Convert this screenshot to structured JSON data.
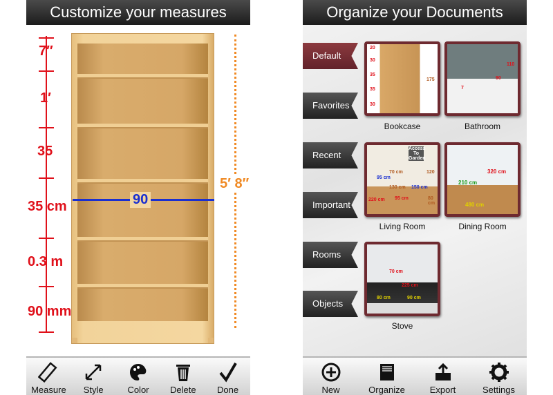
{
  "left": {
    "title": "Customize your measures",
    "ruler_labels": [
      "7″",
      "1′",
      "35",
      "35 cm",
      "0.3 m",
      "90 mm"
    ],
    "width_label": "90",
    "height_label": "5′ 8″",
    "toolbar": [
      {
        "label": "Measure",
        "icon": "ruler-icon"
      },
      {
        "label": "Style",
        "icon": "resize-arrow-icon"
      },
      {
        "label": "Color",
        "icon": "palette-icon"
      },
      {
        "label": "Delete",
        "icon": "trash-icon"
      },
      {
        "label": "Done",
        "icon": "checkmark-icon"
      }
    ]
  },
  "right": {
    "title": "Organize your Documents",
    "tabs": [
      {
        "label": "Default",
        "active": true
      },
      {
        "label": "Favorites"
      },
      {
        "label": "Recent"
      },
      {
        "label": "Important"
      },
      {
        "label": "Rooms"
      },
      {
        "label": "Objects"
      }
    ],
    "documents": [
      {
        "label": "Bookcase",
        "measures": [
          "20",
          "30",
          "35",
          "35",
          "30",
          "175"
        ]
      },
      {
        "label": "Bathroom",
        "measures": [
          "110",
          "90",
          "7"
        ]
      },
      {
        "label": "Living Room",
        "measures": [
          "Access To Garden",
          "70 cm",
          "95 cm",
          "130 cm",
          "150 cm",
          "120",
          "220 cm",
          "95 cm",
          "80 cm"
        ]
      },
      {
        "label": "Dining Room",
        "measures": [
          "320 cm",
          "210 cm",
          "480 cm"
        ]
      },
      {
        "label": "Stove",
        "measures": [
          "70 cm",
          "225 cm",
          "80 cm",
          "90 cm"
        ]
      }
    ],
    "toolbar": [
      {
        "label": "New",
        "icon": "plus-circle-icon"
      },
      {
        "label": "Organize",
        "icon": "inbox-tray-icon"
      },
      {
        "label": "Export",
        "icon": "export-tray-icon"
      },
      {
        "label": "Settings",
        "icon": "gear-icon"
      }
    ]
  },
  "colors": {
    "measure_red": "#e0101a",
    "measure_blue": "#1a2fd0",
    "measure_orange": "#f08a24",
    "tab_active": "#7a2f35",
    "tab_dark": "#333333"
  }
}
